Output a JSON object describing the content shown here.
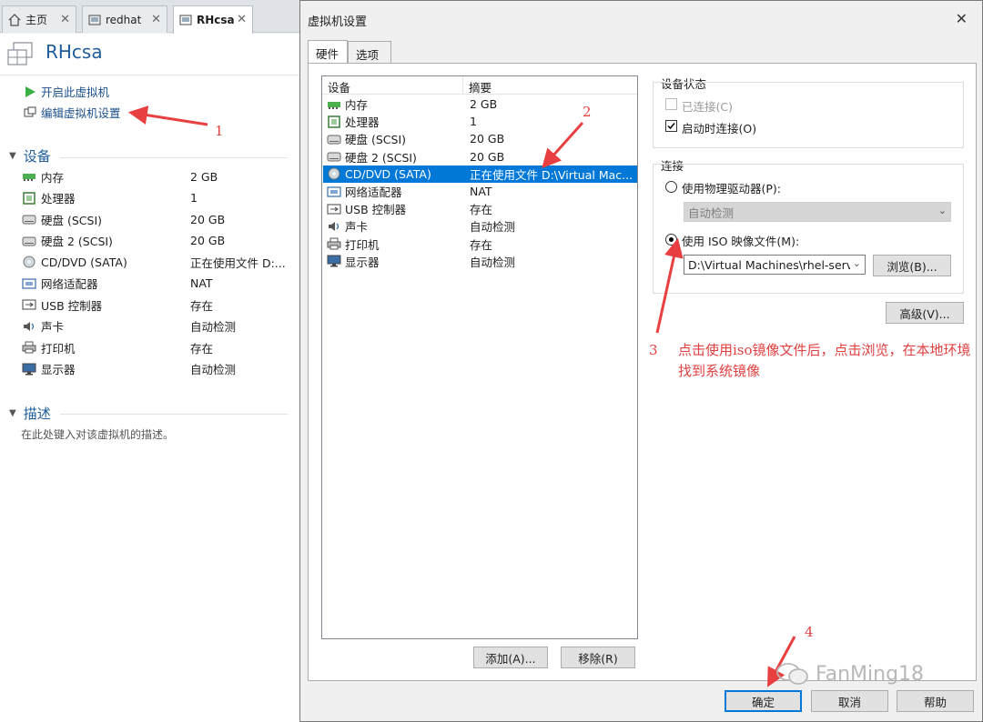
{
  "tabs": [
    {
      "label": "主页",
      "icon": "home-icon"
    },
    {
      "label": "redhat",
      "icon": "vm-icon"
    },
    {
      "label": "RHcsa",
      "icon": "vm-icon",
      "active": true
    }
  ],
  "vm": {
    "name": "RHcsa",
    "actions": {
      "power_on": "开启此虚拟机",
      "edit_settings": "编辑虚拟机设置"
    },
    "devices_header": "设备",
    "devices": [
      {
        "name": "内存",
        "summary": "2 GB",
        "icon": "memory-icon"
      },
      {
        "name": "处理器",
        "summary": "1",
        "icon": "cpu-icon"
      },
      {
        "name": "硬盘 (SCSI)",
        "summary": "20 GB",
        "icon": "harddisk-icon"
      },
      {
        "name": "硬盘 2 (SCSI)",
        "summary": "20 GB",
        "icon": "harddisk-icon"
      },
      {
        "name": "CD/DVD (SATA)",
        "summary": "正在使用文件 D:...",
        "icon": "cdrom-icon"
      },
      {
        "name": "网络适配器",
        "summary": "NAT",
        "icon": "network-icon"
      },
      {
        "name": "USB 控制器",
        "summary": "存在",
        "icon": "usb-icon"
      },
      {
        "name": "声卡",
        "summary": "自动检测",
        "icon": "sound-icon"
      },
      {
        "name": "打印机",
        "summary": "存在",
        "icon": "printer-icon"
      },
      {
        "name": "显示器",
        "summary": "自动检测",
        "icon": "display-icon"
      }
    ],
    "description_header": "描述",
    "description_placeholder": "在此处键入对该虚拟机的描述。"
  },
  "dialog": {
    "title": "虚拟机设置",
    "tabs": [
      "硬件",
      "选项"
    ],
    "list_headers": {
      "device": "设备",
      "summary": "摘要"
    },
    "devices": [
      {
        "name": "内存",
        "summary": "2 GB",
        "icon": "memory-icon"
      },
      {
        "name": "处理器",
        "summary": "1",
        "icon": "cpu-icon"
      },
      {
        "name": "硬盘 (SCSI)",
        "summary": "20 GB",
        "icon": "harddisk-icon"
      },
      {
        "name": "硬盘 2 (SCSI)",
        "summary": "20 GB",
        "icon": "harddisk-icon"
      },
      {
        "name": "CD/DVD (SATA)",
        "summary": "正在使用文件 D:\\Virtual Mac...",
        "icon": "cdrom-icon",
        "selected": true
      },
      {
        "name": "网络适配器",
        "summary": "NAT",
        "icon": "network-icon"
      },
      {
        "name": "USB 控制器",
        "summary": "存在",
        "icon": "usb-icon"
      },
      {
        "name": "声卡",
        "summary": "自动检测",
        "icon": "sound-icon"
      },
      {
        "name": "打印机",
        "summary": "存在",
        "icon": "printer-icon"
      },
      {
        "name": "显示器",
        "summary": "自动检测",
        "icon": "display-icon"
      }
    ],
    "add_button": "添加(A)...",
    "remove_button": "移除(R)",
    "device_status": {
      "label": "设备状态",
      "connected": {
        "label": "已连接(C)",
        "checked": false,
        "disabled": true
      },
      "connect_at_power_on": {
        "label": "启动时连接(O)",
        "checked": true
      }
    },
    "connection": {
      "label": "连接",
      "physical": {
        "label": "使用物理驱动器(P):",
        "selected": false,
        "value": "自动检测"
      },
      "iso": {
        "label": "使用 ISO 映像文件(M):",
        "selected": true,
        "value": "D:\\Virtual Machines\\rhel-server"
      },
      "browse_button": "浏览(B)..."
    },
    "advanced_button": "高级(V)...",
    "ok_button": "确定",
    "cancel_button": "取消",
    "help_button": "帮助"
  },
  "annotations": {
    "n1": "1",
    "n2": "2",
    "n3": "3",
    "n4": "4",
    "note": "点击使用iso镜像文件后，点击浏览，在本地环境找到系统镜像"
  },
  "watermark": "FanMing18",
  "colors": {
    "accent": "#0078d7",
    "annotation": "#e04040",
    "title_blue": "#1e5c9b"
  }
}
